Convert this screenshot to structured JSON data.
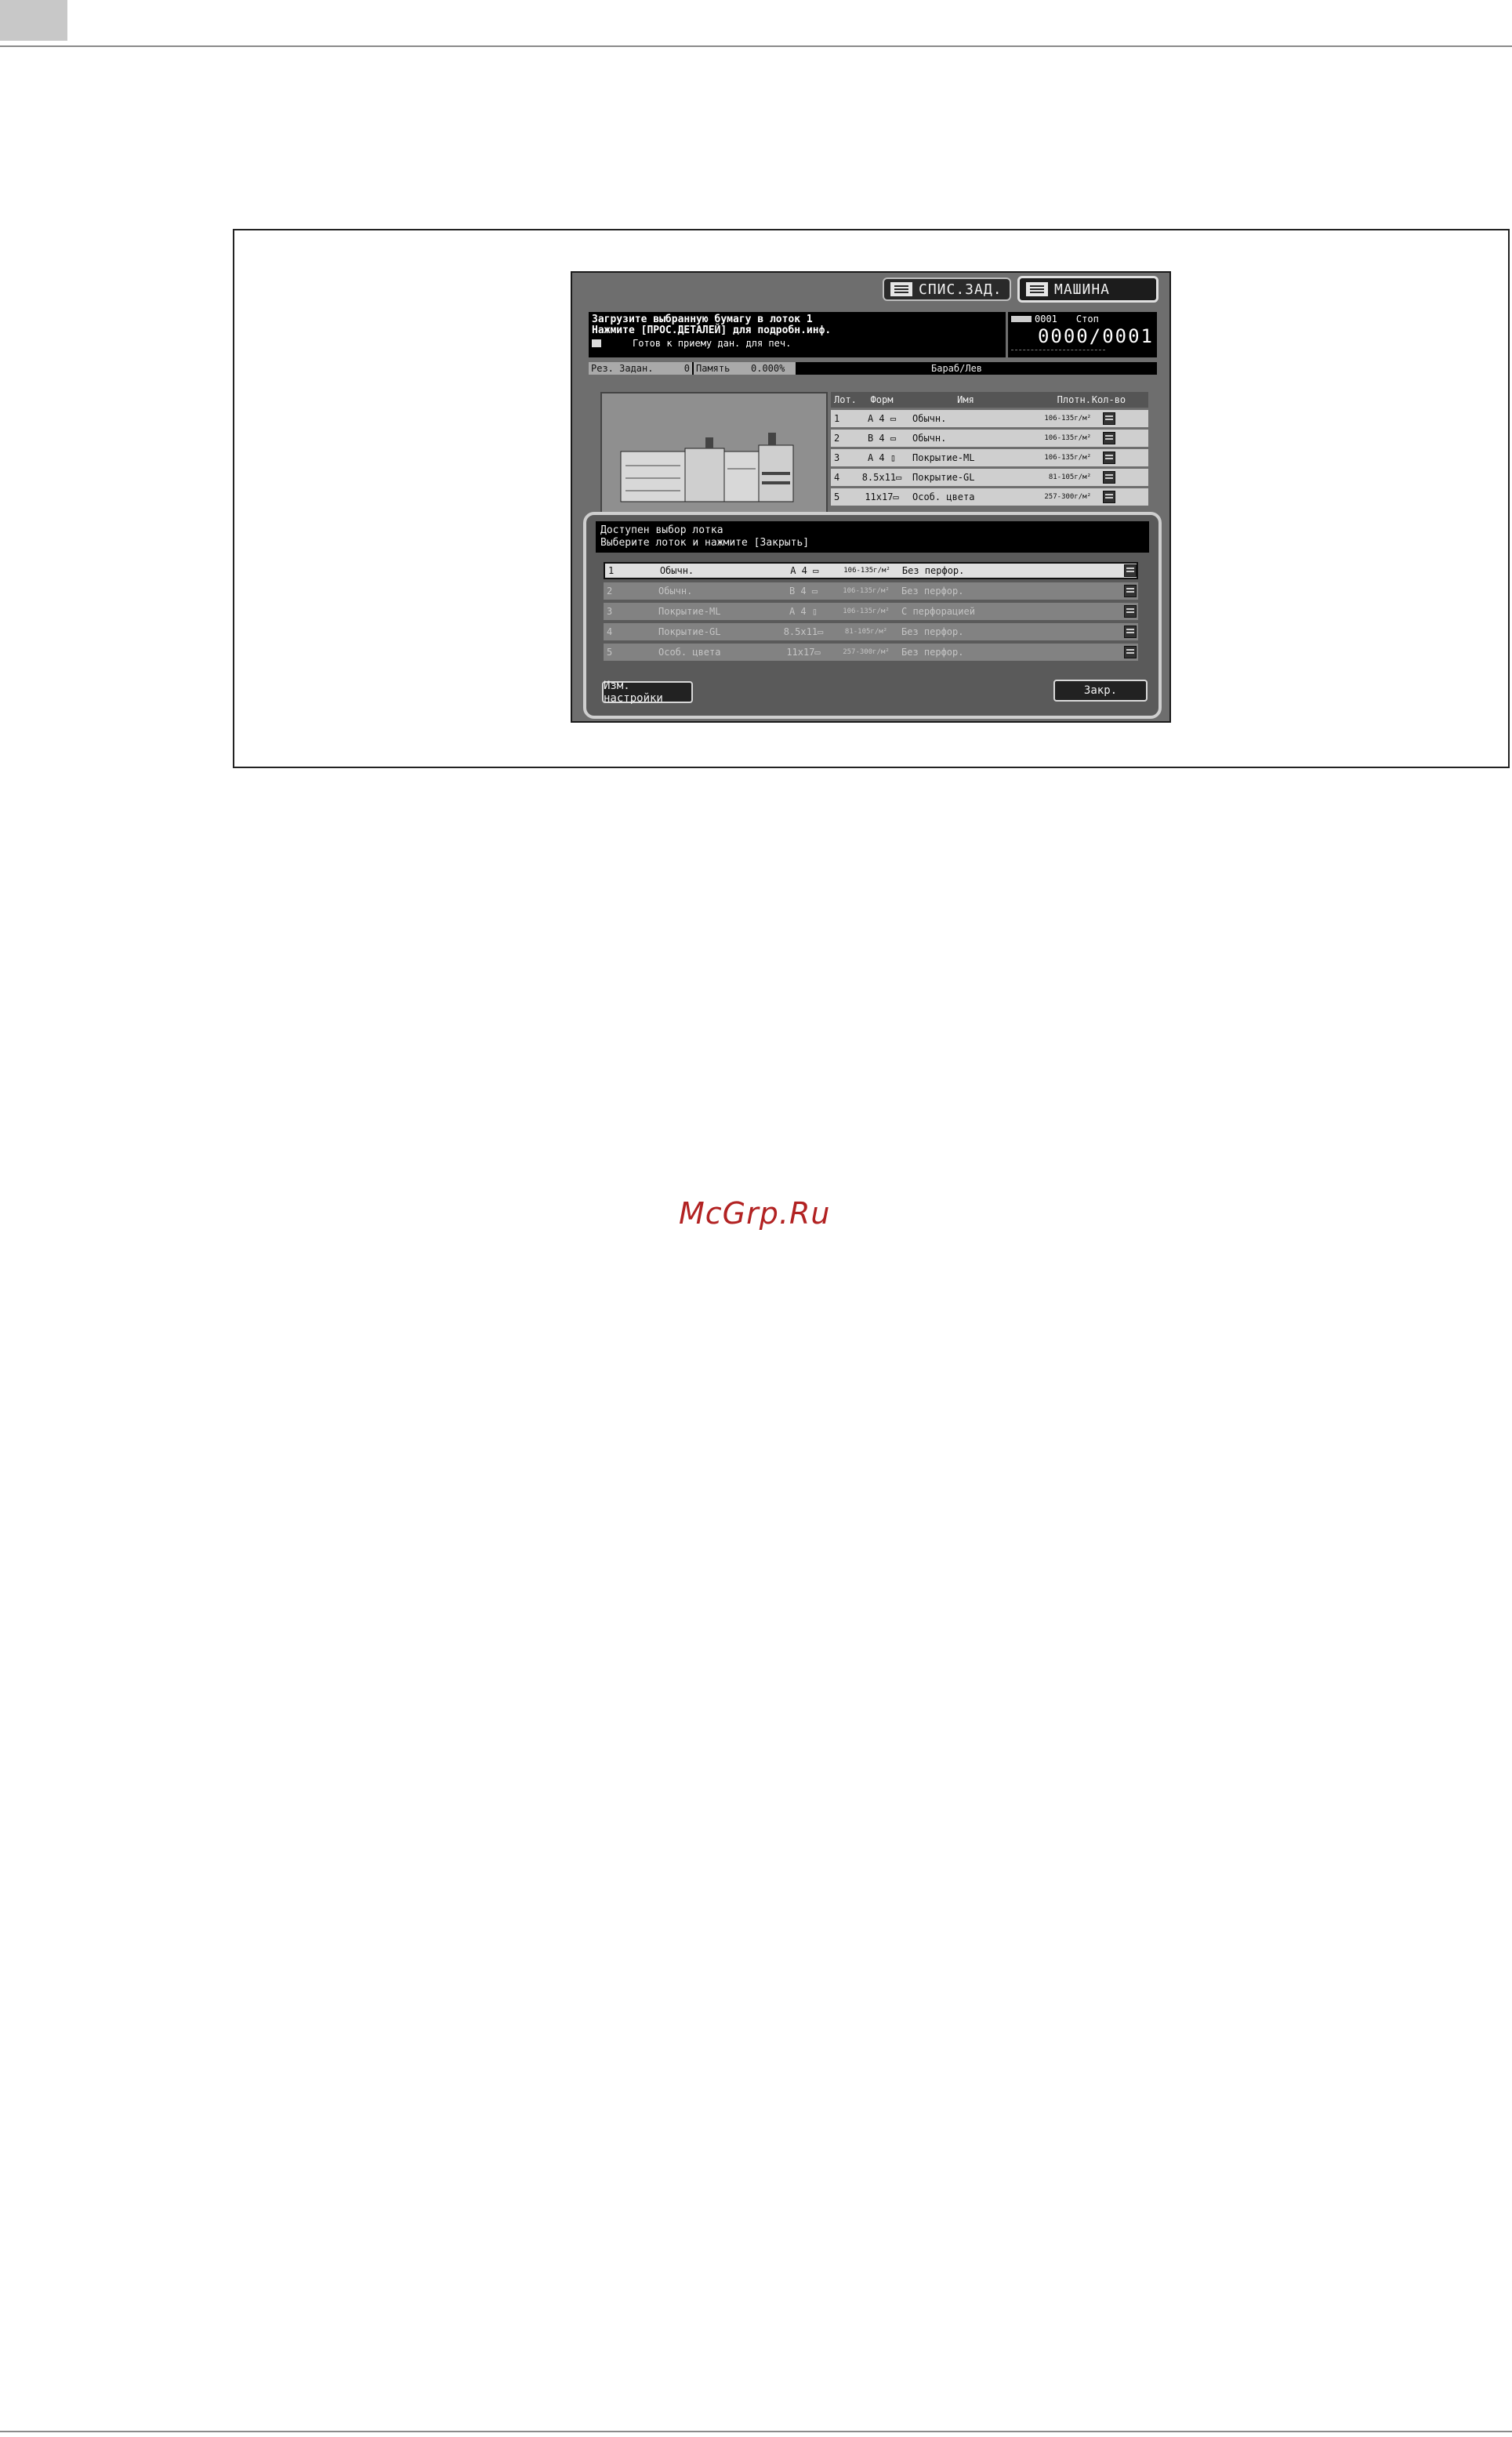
{
  "tabs": {
    "job_list": "СПИС.ЗАД.",
    "machine": "МАШИНА"
  },
  "message": {
    "line1": "Загрузите выбранную бумагу в лоток 1",
    "line2": "Нажмите [ПРОС.ДЕТАЛЕЙ] для подробн.инф.",
    "line3": "Готов к приему дан. для печ."
  },
  "counter": {
    "job_no": "0001",
    "state": "Стоп",
    "value": "0000/0001"
  },
  "status": {
    "reserve_label": "Рез. Задан.",
    "reserve_count": "0",
    "memory_label": "Память",
    "memory_value": "0.000%",
    "drum_label": "Бараб/Лев"
  },
  "tray_table": {
    "headers": {
      "lot": "Лот.",
      "form": "Форм",
      "name": "Имя",
      "density": "Плотн.",
      "qty": "Кол-во"
    },
    "rows": [
      {
        "lot": "1",
        "form": "A 4 ▭",
        "name": "Обычн.",
        "density": "106-135г/м²"
      },
      {
        "lot": "2",
        "form": "B 4 ▭",
        "name": "Обычн.",
        "density": "106-135г/м²"
      },
      {
        "lot": "3",
        "form": "A 4 ▯",
        "name": "Покрытие-ML",
        "density": "106-135г/м²"
      },
      {
        "lot": "4",
        "form": "8.5x11▭",
        "name": "Покрытие-GL",
        "density": "81-105г/м²"
      },
      {
        "lot": "5",
        "form": "11x17▭",
        "name": "Особ. цвета",
        "density": "257-300г/м²"
      }
    ]
  },
  "dialog": {
    "line1": "Доступен выбор лотка",
    "line2": "Выберите лоток и нажмите [Закрыть]",
    "rows": [
      {
        "lot": "1",
        "name": "Обычн.",
        "form": "A 4 ▭",
        "density": "106-135г/м²",
        "punch": "Без перфор."
      },
      {
        "lot": "2",
        "name": "Обычн.",
        "form": "B 4 ▭",
        "density": "106-135г/м²",
        "punch": "Без перфор."
      },
      {
        "lot": "3",
        "name": "Покрытие-ML",
        "form": "A 4 ▯",
        "density": "106-135г/м²",
        "punch": "С перфорацией"
      },
      {
        "lot": "4",
        "name": "Покрытие-GL",
        "form": "8.5x11▭",
        "density": "81-105г/м²",
        "punch": "Без перфор."
      },
      {
        "lot": "5",
        "name": "Особ. цвета",
        "form": "11x17▭",
        "density": "257-300г/м²",
        "punch": "Без перфор."
      }
    ],
    "change_settings_label": "Изм. настройки",
    "close_label": "Закр."
  },
  "watermark": "McGrp.Ru"
}
